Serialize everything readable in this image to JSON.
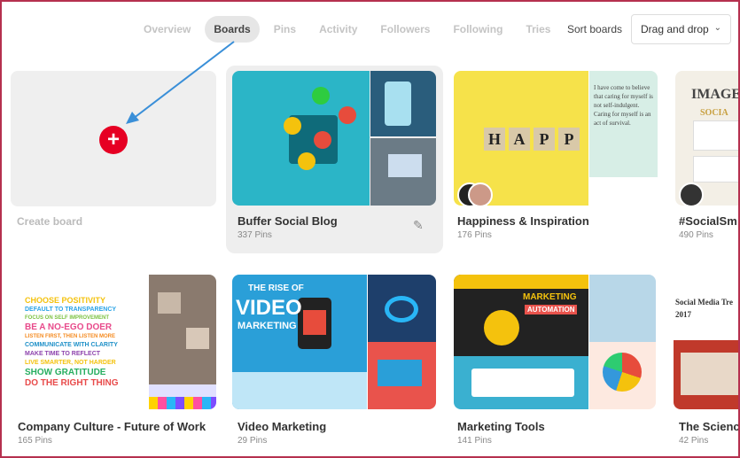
{
  "nav": {
    "tabs": [
      {
        "label": "Overview",
        "active": false
      },
      {
        "label": "Boards",
        "active": true
      },
      {
        "label": "Pins",
        "active": false
      },
      {
        "label": "Activity",
        "active": false
      },
      {
        "label": "Followers",
        "active": false
      },
      {
        "label": "Following",
        "active": false
      },
      {
        "label": "Tries",
        "active": false
      }
    ],
    "sort_label": "Sort boards",
    "sort_value": "Drag and drop"
  },
  "create": {
    "label": "Create board",
    "icon": "plus-icon"
  },
  "boards": [
    {
      "title": "Buffer Social Blog",
      "count": "337 Pins"
    },
    {
      "title": "Happiness & Inspiration",
      "count": "176 Pins"
    },
    {
      "title": "#SocialSm",
      "count": "490 Pins"
    },
    {
      "title": "Company Culture - Future of Work",
      "count": "165 Pins"
    },
    {
      "title": "Video Marketing",
      "count": "29 Pins"
    },
    {
      "title": "Marketing Tools",
      "count": "141 Pins"
    },
    {
      "title": "The Scienc",
      "count": "42 Pins"
    }
  ],
  "covers": {
    "happy_letters": [
      "H",
      "A",
      "P",
      "P"
    ],
    "happy_quote": "I have come to believe that caring for myself is not self-indulgent. Caring for myself is an act of survival.",
    "culture_lines": [
      "CHOOSE POSITIVITY",
      "DEFAULT TO TRANSPARENCY",
      "FOCUS ON SELF IMPROVEMENT",
      "BE A NO-EGO DOER",
      "LISTEN FIRST, THEN LISTEN MORE",
      "COMMUNICATE WITH CLARITY",
      "MAKE TIME TO REFLECT",
      "LIVE SMARTER, NOT HARDER",
      "SHOW GRATITUDE",
      "DO THE RIGHT THING"
    ],
    "video_headline_1": "THE RISE OF",
    "video_headline_2": "VIDEO",
    "video_headline_3": "MARKETING",
    "tools_headline_1": "MARKETING",
    "tools_headline_2": "AUTOMATION",
    "science_text": "Social Media Tre 2017",
    "social_label": "IMAGE",
    "social_label_2": "SOCIA"
  },
  "colors": {
    "accent_red": "#e60023",
    "annotation_blue": "#3a8fd8",
    "frame_border": "#b5304f"
  }
}
